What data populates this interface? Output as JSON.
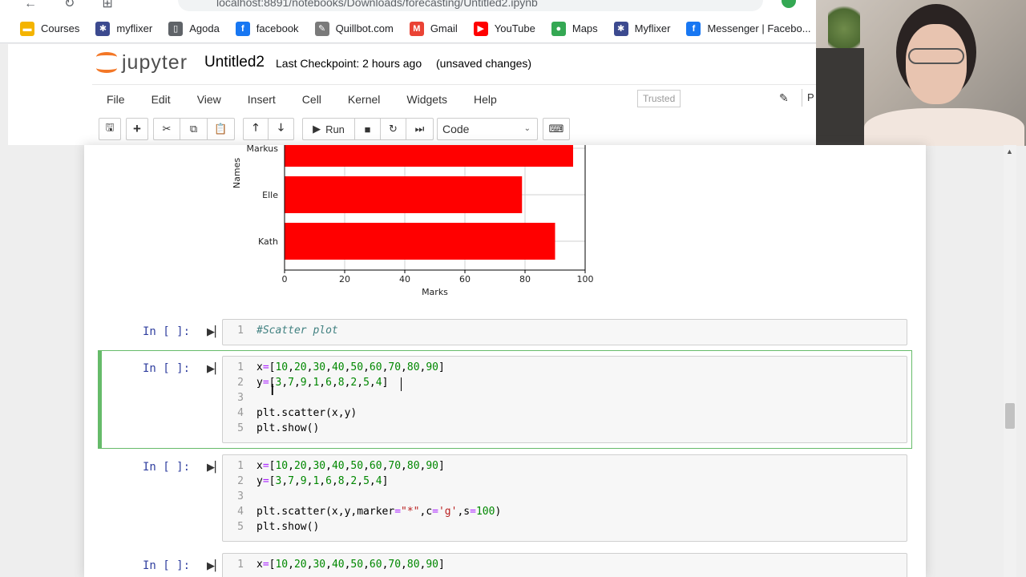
{
  "browser": {
    "url": "localhost:8891/notebooks/Downloads/forecasting/Untitled2.ipynb",
    "bookmarks": [
      {
        "label": "Courses",
        "icon": "folder-icon",
        "color": "#f4b400"
      },
      {
        "label": "myflixer",
        "icon": "globe-icon",
        "color": "#3c4a8f"
      },
      {
        "label": "Agoda",
        "icon": "page-icon",
        "color": "#5f6368"
      },
      {
        "label": "facebook",
        "icon": "facebook-icon",
        "color": "#1877f2"
      },
      {
        "label": "Quillbot.com",
        "icon": "quill-icon",
        "color": "#7a7a7a"
      },
      {
        "label": "Gmail",
        "icon": "gmail-icon",
        "color": "#ea4335"
      },
      {
        "label": "YouTube",
        "icon": "youtube-icon",
        "color": "#ff0000"
      },
      {
        "label": "Maps",
        "icon": "maps-icon",
        "color": "#34a853"
      },
      {
        "label": "Myflixer",
        "icon": "globe-icon",
        "color": "#3c4a8f"
      },
      {
        "label": "Messenger | Facebo...",
        "icon": "facebook-icon",
        "color": "#1877f2"
      }
    ]
  },
  "jupyter": {
    "logo_text": "jupyter",
    "notebook_title": "Untitled2",
    "checkpoint": "Last Checkpoint: 2 hours ago",
    "status": "(unsaved changes)",
    "menu": [
      "File",
      "Edit",
      "View",
      "Insert",
      "Cell",
      "Kernel",
      "Widgets",
      "Help"
    ],
    "trusted_label": "Trusted",
    "kernel_fragment": "P",
    "toolbar": {
      "run_label": "Run",
      "cell_type": "Code"
    },
    "accent": "#f37726"
  },
  "chart_data": {
    "type": "bar",
    "orientation": "horizontal",
    "categories": [
      "Kath",
      "Elle",
      "Markus"
    ],
    "values": [
      90,
      79,
      96
    ],
    "xlabel": "Marks",
    "ylabel": "Names",
    "xlim": [
      0,
      100
    ],
    "xticks": [
      "0",
      "20",
      "40",
      "60",
      "80",
      "100"
    ],
    "color": "#ff0000",
    "grid": true
  },
  "cells": [
    {
      "prompt": "In [ ]:",
      "lines": [
        "#Scatter plot"
      ]
    },
    {
      "prompt": "In [ ]:",
      "lines": [
        "x=[10,20,30,40,50,60,70,80,90]",
        "y=[3,7,9,1,6,8,2,5,4]",
        "",
        "plt.scatter(x,y)",
        "plt.show()"
      ]
    },
    {
      "prompt": "In [ ]:",
      "lines": [
        "x=[10,20,30,40,50,60,70,80,90]",
        "y=[3,7,9,1,6,8,2,5,4]",
        "",
        "plt.scatter(x,y,marker=\"*\",c='g',s=100)",
        "plt.show()"
      ]
    },
    {
      "prompt": "In [ ]:",
      "lines": [
        "x=[10,20,30,40,50,60,70,80,90]"
      ]
    }
  ]
}
